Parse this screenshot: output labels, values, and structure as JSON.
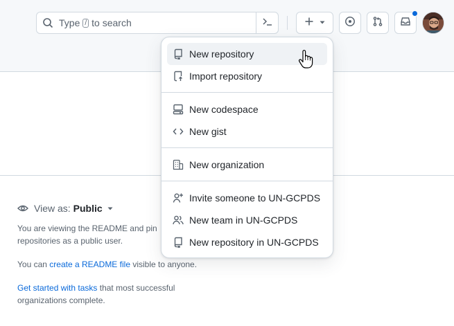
{
  "header": {
    "search": {
      "prefix": "Type",
      "key": "/",
      "suffix": "to search"
    }
  },
  "create_menu": {
    "items": [
      {
        "label": "New repository",
        "icon": "repo-icon"
      },
      {
        "label": "Import repository",
        "icon": "repo-push-icon"
      },
      {
        "label": "New codespace",
        "icon": "codespaces-icon"
      },
      {
        "label": "New gist",
        "icon": "code-icon"
      },
      {
        "label": "New organization",
        "icon": "organization-icon"
      },
      {
        "label": "Invite someone to UN-GCPDS",
        "icon": "person-add-icon"
      },
      {
        "label": "New team in UN-GCPDS",
        "icon": "people-icon"
      },
      {
        "label": "New repository in UN-GCPDS",
        "icon": "repo-icon"
      }
    ]
  },
  "view_as": {
    "label": "View as:",
    "value": "Public"
  },
  "info": {
    "p1": "You are viewing the README and pin",
    "p1b": "repositories as a public user.",
    "p2_prefix": "You can",
    "p2_link": "create a README file",
    "p2_suffix": "visible to anyone.",
    "p3_link": "Get started with tasks",
    "p3_suffix": "that most successful",
    "p3b": "organizations complete."
  },
  "colors": {
    "accent": "#0969da",
    "header_bg": "#f6f8fa",
    "border": "#d1d9e0",
    "muted_text": "#59636e"
  }
}
